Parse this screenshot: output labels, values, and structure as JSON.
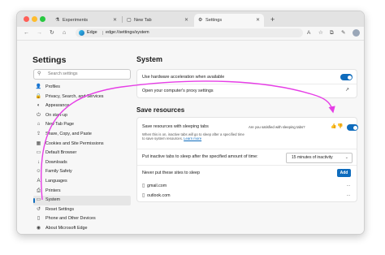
{
  "tabs": [
    {
      "label": "Experiments",
      "icon": "beaker-icon"
    },
    {
      "label": "New Tab",
      "icon": "newtab-icon"
    },
    {
      "label": "Settings",
      "icon": "gear-icon"
    }
  ],
  "address": {
    "brand": "Edge",
    "url": "edge://settings/system"
  },
  "sidebar": {
    "title": "Settings",
    "search_placeholder": "Search settings",
    "items": [
      {
        "label": "Profiles",
        "icon": "profile-icon"
      },
      {
        "label": "Privacy, Search, and Services",
        "icon": "lock-icon"
      },
      {
        "label": "Appearance",
        "icon": "appearance-icon"
      },
      {
        "label": "On start-up",
        "icon": "power-icon"
      },
      {
        "label": "New Tab Page",
        "icon": "home-icon"
      },
      {
        "label": "Share, Copy, and Paste",
        "icon": "share-icon"
      },
      {
        "label": "Cookies and Site Permissions",
        "icon": "cookie-icon"
      },
      {
        "label": "Default Browser",
        "icon": "browser-icon"
      },
      {
        "label": "Downloads",
        "icon": "download-icon"
      },
      {
        "label": "Family Safety",
        "icon": "family-icon"
      },
      {
        "label": "Languages",
        "icon": "language-icon"
      },
      {
        "label": "Printers",
        "icon": "printer-icon"
      },
      {
        "label": "System",
        "icon": "monitor-icon",
        "active": true
      },
      {
        "label": "Reset Settings",
        "icon": "reset-icon"
      },
      {
        "label": "Phone and Other Devices",
        "icon": "phone-icon"
      },
      {
        "label": "About Microsoft Edge",
        "icon": "edge-icon"
      }
    ]
  },
  "main": {
    "system": {
      "title": "System",
      "hardware_accel_label": "Use hardware acceleration when available",
      "hardware_accel_on": true,
      "proxy_label": "Open your computer's proxy settings"
    },
    "save_resources": {
      "title": "Save resources",
      "sleeping_tabs_label": "Save resources with sleeping tabs",
      "sleeping_tabs_desc": "When this is on, inactive tabs will go to sleep after a specified time to save system resources.",
      "learn_more": "Learn more",
      "feedback_question": "Are you satisfied with sleeping tabs?",
      "sleeping_tabs_on": true,
      "inactive_label": "Put inactive tabs to sleep after the specified amount of time:",
      "inactive_value": "15 minutes of inactivity",
      "never_sleep_label": "Never put these sites to sleep",
      "add_label": "Add",
      "sites": [
        "gmail.com",
        "outlook.com"
      ]
    }
  },
  "colors": {
    "accent": "#0f6cbd",
    "arrow": "#e63ee6"
  }
}
